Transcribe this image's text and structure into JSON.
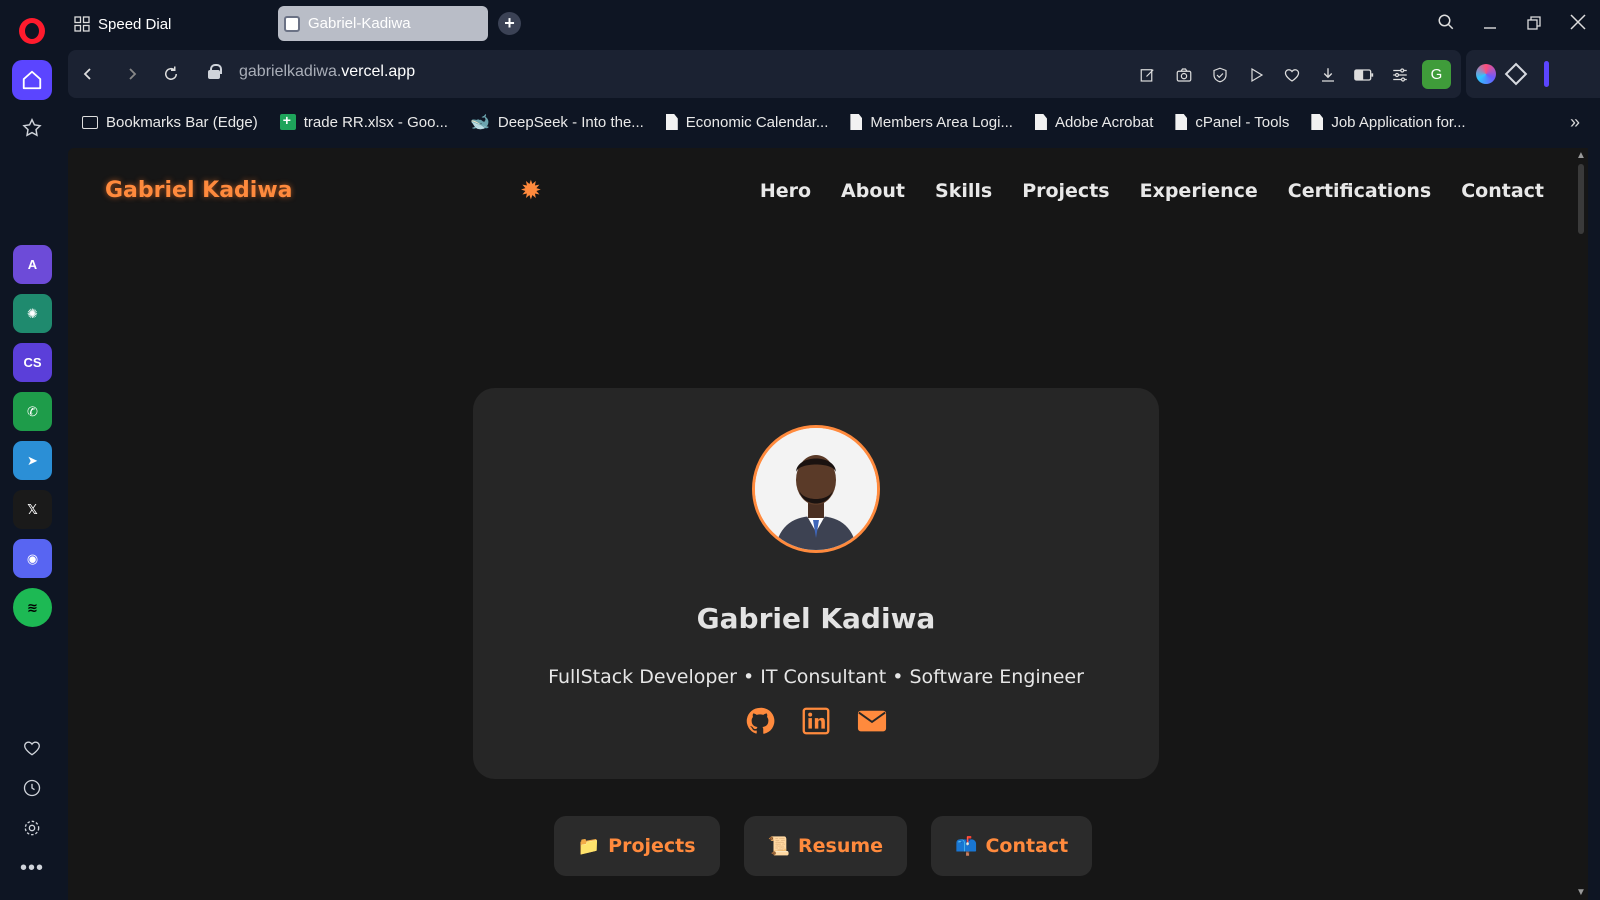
{
  "browser": {
    "tabs": [
      {
        "label": "Speed Dial",
        "active": false
      },
      {
        "label": "Gabriel-Kadiwa",
        "active": true
      }
    ],
    "new_tab_symbol": "+",
    "url_host_prefix": "gabrielkadiwa.",
    "url_host_main": "vercel.app",
    "profile_initial": "G",
    "bookmarks": [
      {
        "label": "Bookmarks Bar (Edge)",
        "icon": "folder-icon"
      },
      {
        "label": "trade RR.xlsx - Goo...",
        "icon": "sheets-icon"
      },
      {
        "label": "DeepSeek - Into the...",
        "icon": "deepseek-icon"
      },
      {
        "label": "Economic Calendar...",
        "icon": "document-icon"
      },
      {
        "label": "Members Area Logi...",
        "icon": "document-icon"
      },
      {
        "label": "Adobe Acrobat",
        "icon": "document-icon"
      },
      {
        "label": "cPanel - Tools",
        "icon": "document-icon"
      },
      {
        "label": "Job Application for...",
        "icon": "document-icon"
      }
    ],
    "sidebar_apps": [
      {
        "name": "aria",
        "glyph": "A"
      },
      {
        "name": "chatgpt",
        "glyph": "✺"
      },
      {
        "name": "cs",
        "glyph": "CS"
      },
      {
        "name": "whatsapp",
        "glyph": "✆"
      },
      {
        "name": "telegram",
        "glyph": "➤"
      },
      {
        "name": "x",
        "glyph": "𝕏"
      },
      {
        "name": "discord",
        "glyph": "◉"
      },
      {
        "name": "spotify",
        "glyph": "≋"
      }
    ],
    "colors": {
      "accent": "#5b45ff",
      "chrome_bg": "#0e1523",
      "toolbar_bg": "#1b2232"
    }
  },
  "site": {
    "logo": "Gabriel Kadiwa",
    "theme_toggle_icon": "sun-icon",
    "nav": [
      "Hero",
      "About",
      "Skills",
      "Projects",
      "Experience",
      "Certifications",
      "Contact"
    ],
    "hero": {
      "name": "Gabriel Kadiwa",
      "roles": "FullStack Developer • IT Consultant • Software Engineer",
      "socials": [
        "github-icon",
        "linkedin-icon",
        "email-icon"
      ]
    },
    "cta": [
      {
        "emoji": "📁",
        "label": "Projects"
      },
      {
        "emoji": "📜",
        "label": "Resume"
      },
      {
        "emoji": "📫",
        "label": "Contact"
      }
    ],
    "colors": {
      "accent": "#ff8a3d",
      "page_bg": "#161616",
      "card_bg": "#262626"
    }
  }
}
